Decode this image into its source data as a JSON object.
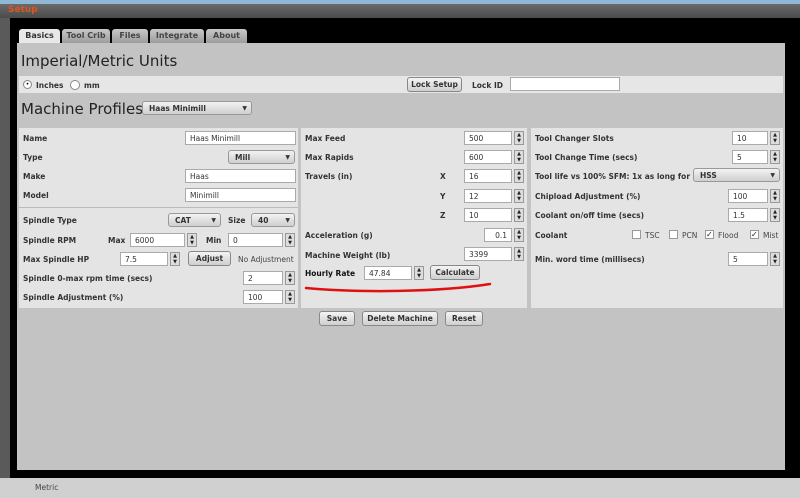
{
  "window": {
    "title": "Setup"
  },
  "tabs": [
    "Basics",
    "Tool Crib",
    "Files",
    "Integrate",
    "About"
  ],
  "units": {
    "heading": "Imperial/Metric Units",
    "options": [
      "Inches",
      "mm"
    ],
    "selected": "Inches",
    "lock_setup": "Lock Setup",
    "lock_id_label": "Lock ID",
    "lock_id_value": ""
  },
  "profiles": {
    "heading": "Machine Profiles",
    "selected": "Haas Minimill"
  },
  "col1": {
    "name_label": "Name",
    "name": "Haas Minimill",
    "type_label": "Type",
    "type": "Mill",
    "make_label": "Make",
    "make": "Haas",
    "model_label": "Model",
    "model": "Minimill",
    "spindle_type_label": "Spindle Type",
    "spindle_type": "CAT",
    "size_label": "Size",
    "size": "40",
    "rpm_label": "Spindle RPM",
    "max_label": "Max",
    "max": "6000",
    "min_label": "Min",
    "min": "0",
    "hp_label": "Max Spindle HP",
    "hp": "7.5",
    "adjust": "Adjust",
    "adjust_status": "No Adjustment",
    "ramp_label": "Spindle 0-max rpm time (secs)",
    "ramp": "2",
    "spindle_adj_label": "Spindle Adjustment (%)",
    "spindle_adj": "100"
  },
  "col2": {
    "max_feed_label": "Max Feed",
    "max_feed": "500",
    "max_rapids_label": "Max Rapids",
    "max_rapids": "600",
    "travels_label": "Travels (in)",
    "x_label": "X",
    "x": "16",
    "y_label": "Y",
    "y": "12",
    "z_label": "Z",
    "z": "10",
    "accel_label": "Acceleration (g)",
    "accel": "0.1",
    "weight_label": "Machine Weight (lb)",
    "weight": "3399",
    "rate_label": "Hourly Rate",
    "rate": "47.84",
    "calculate": "Calculate"
  },
  "col3": {
    "slots_label": "Tool Changer Slots",
    "slots": "10",
    "tc_time_label": "Tool Change Time (secs)",
    "tc_time": "5",
    "tool_life_label": "Tool life vs 100% SFM: 1x as long for",
    "tool_life": "HSS",
    "chipload_label": "Chipload Adjustment (%)",
    "chipload": "100",
    "coolant_time_label": "Coolant on/off time (secs)",
    "coolant_time": "1.5",
    "coolant_label": "Coolant",
    "coolant_opts": [
      {
        "label": "TSC",
        "checked": false
      },
      {
        "label": "PCN",
        "checked": false
      },
      {
        "label": "Flood",
        "checked": true
      },
      {
        "label": "Mist",
        "checked": true
      }
    ],
    "word_time_label": "Min. word time (millisecs)",
    "word_time": "5"
  },
  "actions": {
    "save": "Save",
    "delete": "Delete Machine",
    "reset": "Reset"
  },
  "status": {
    "text": "Metric"
  },
  "colors": {
    "title": "#e0541e",
    "annotation": "#e01010"
  }
}
